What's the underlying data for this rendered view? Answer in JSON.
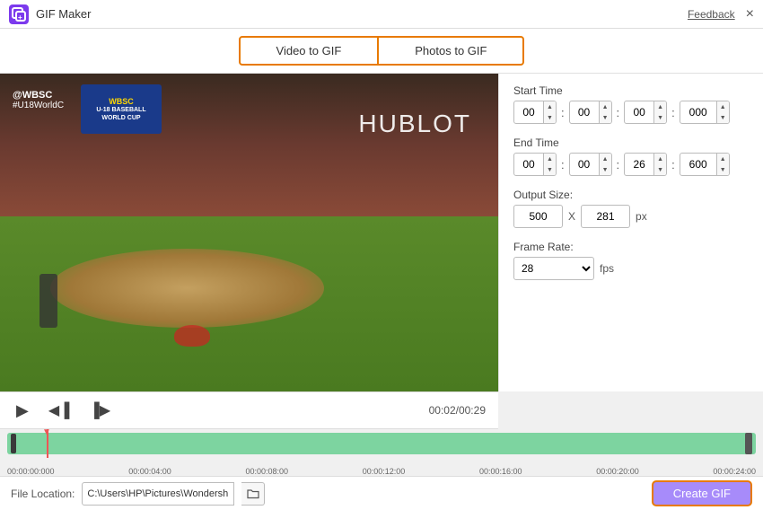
{
  "titleBar": {
    "appTitle": "GIF Maker",
    "feedbackLabel": "Feedback",
    "closeLabel": "×",
    "logoText": "G+"
  },
  "tabs": {
    "videoToGif": "Video to GIF",
    "photosToGif": "Photos to GIF"
  },
  "controls": {
    "startTimeLabel": "Start Time",
    "endTimeLabel": "End Time",
    "outputSizeLabel": "Output Size:",
    "frameRateLabel": "Frame Rate:",
    "startH": "00",
    "startM": "00",
    "startS": "00",
    "startMs": "000",
    "endH": "00",
    "endM": "00",
    "endS": "26",
    "endMs": "600",
    "outputW": "500",
    "outputH": "281",
    "pxLabel": "px",
    "xLabel": "X",
    "frameRateValue": "28",
    "fpsLabel": "fps"
  },
  "playback": {
    "timeDisplay": "00:02/00:29"
  },
  "timeline": {
    "timestamps": [
      "00:00:00:000",
      "00:00:04:00",
      "00:00:08:00",
      "00:00:12:00",
      "00:00:16:00",
      "00:00:20:00",
      "00:00:24:00"
    ]
  },
  "bottomBar": {
    "fileLocationLabel": "File Location:",
    "filePath": "C:\\Users\\HP\\Pictures\\Wondersh",
    "createGifLabel": "Create GIF"
  },
  "video": {
    "overlayText1": "@WBSC",
    "overlayText2": "#U18WorldC",
    "wbscLine1": "U-18 BASEBALL",
    "wbscLine2": "WORLD CUP",
    "hublotText": "HUBLOT"
  }
}
